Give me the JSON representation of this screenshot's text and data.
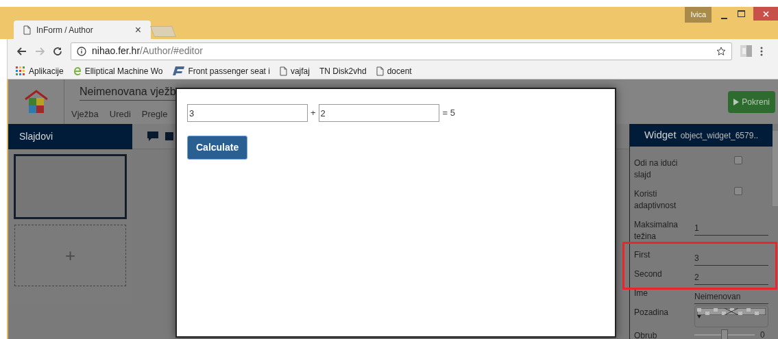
{
  "browser": {
    "profile": "Ivica",
    "tab": {
      "title": "InForm / Author",
      "close": "×"
    },
    "url": {
      "host": "nihao.fer.hr",
      "path": "/Author/#editor"
    },
    "bookmarks": [
      {
        "kind": "apps",
        "label": "Aplikacije"
      },
      {
        "kind": "e",
        "label": "Elliptical Machine Wo"
      },
      {
        "kind": "r",
        "label": "Front passenger seat i"
      },
      {
        "kind": "page",
        "label": "vajfaj"
      },
      {
        "kind": "none",
        "label": "TN Disk2vhd"
      },
      {
        "kind": "page",
        "label": "docent"
      }
    ]
  },
  "app": {
    "title": "Neimenovana vježb",
    "menu": [
      "Vježba",
      "Uredi",
      "Pregle"
    ],
    "run_button": "Pokreni",
    "slides_panel": {
      "title": "Slajdovi",
      "add": "+"
    },
    "properties": {
      "title": "Widget",
      "id": "object_widget_6579..",
      "rows": [
        {
          "kind": "checkbox",
          "label": "Odi na idući slajd",
          "checked": false
        },
        {
          "kind": "checkbox",
          "label": "Koristi adaptivnost",
          "checked": false
        },
        {
          "kind": "text",
          "label": "Maksimalna težina",
          "value": "1"
        },
        {
          "kind": "text",
          "label": "First",
          "value": "3"
        },
        {
          "kind": "text",
          "label": "Second",
          "value": "2"
        },
        {
          "kind": "text",
          "label": "Ime",
          "value": "Neimenovan"
        },
        {
          "kind": "color",
          "label": "Pozadina"
        },
        {
          "kind": "slider",
          "label": "Obrub",
          "level": 0.5,
          "reading": "0"
        }
      ]
    }
  },
  "dialog": {
    "first": "3",
    "operator": "+",
    "second": "2",
    "result": "= 5",
    "button": "Calculate"
  }
}
